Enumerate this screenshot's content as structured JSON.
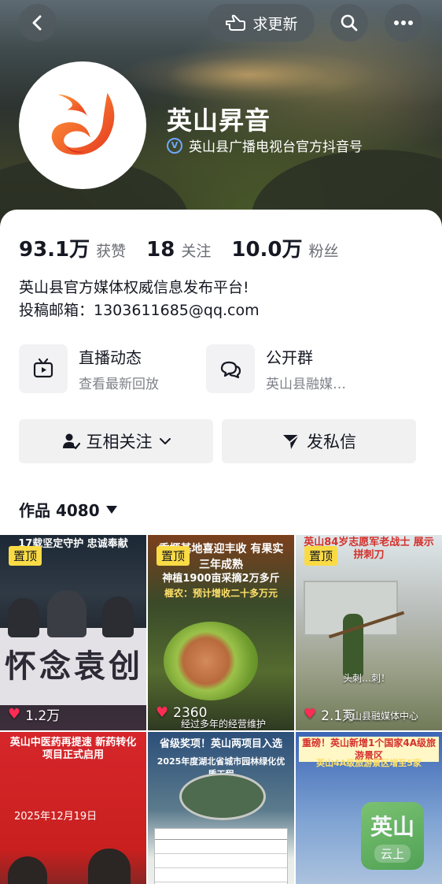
{
  "header": {
    "update_label": "求更新"
  },
  "profile": {
    "name": "英山昇音",
    "verify_text": "英山县广播电视台官方抖音号"
  },
  "stats": [
    {
      "value": "93.1万",
      "label": "获赞"
    },
    {
      "value": "18",
      "label": "关注"
    },
    {
      "value": "10.0万",
      "label": "粉丝"
    }
  ],
  "bio": {
    "line1": "英山县官方媒体权威信息发布平台!",
    "line2": "投稿邮箱：1303611685@qq.com"
  },
  "features": [
    {
      "title": "直播动态",
      "subtitle": "查看最新回放",
      "icon": "live-tv-icon"
    },
    {
      "title": "公开群",
      "subtitle": "英山县融媒…",
      "icon": "chat-group-icon"
    }
  ],
  "actions": {
    "follow_label": "互相关注",
    "message_label": "发私信"
  },
  "works": {
    "tab_label": "作品 4080"
  },
  "grid": [
    {
      "pin": "置顶",
      "likes": "1.2万",
      "headline": "17载坚定守护 忠诚奉献",
      "banner": "怀念袁创"
    },
    {
      "pin": "置顶",
      "likes": "2360",
      "headline": "香榧基地喜迎丰收 有果实三年成熟",
      "sub": "神植1900亩采摘2万多斤",
      "sub2": "榧农：预计增收二十多万元",
      "caption": "经过多年的经营维护"
    },
    {
      "pin": "置顶",
      "likes": "2.1万",
      "headline": "英山84岁志愿军老战士 展示拼刺刀",
      "caption": "头刺…刺！",
      "caption2": "英山县融媒体中心"
    },
    {
      "headline": "英山中医药再提速 新药转化项目正式启用",
      "date": "2025年12月19日"
    },
    {
      "headline": "省级奖项！英山两项目入选",
      "sub": "2025年度湖北省城市园林绿化优质工程"
    },
    {
      "headline": "重磅！英山新增1个国家4A级旅游景区",
      "sub": "英山4A级旅游景区增至5家"
    }
  ],
  "badge": {
    "big": "英山",
    "small": "云上"
  },
  "colors": {
    "accent_pink": "#fe2c55",
    "pin_yellow": "#fadb45",
    "text_primary": "#161823",
    "text_secondary": "#80828a"
  }
}
